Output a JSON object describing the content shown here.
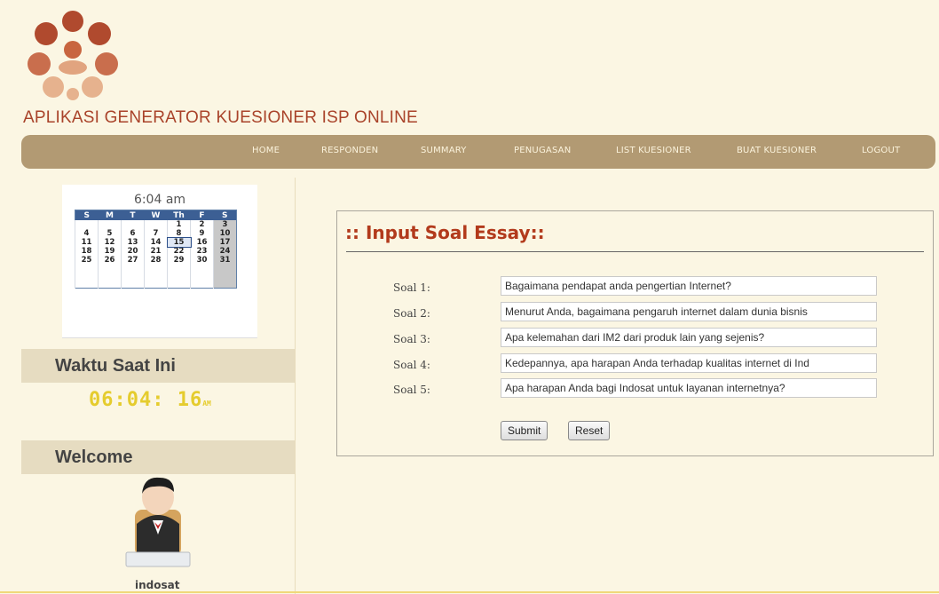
{
  "app": {
    "title": "APLIKASI GENERATOR KUESIONER ISP ONLINE"
  },
  "nav": {
    "items": [
      {
        "label": "HOME"
      },
      {
        "label": "RESPONDEN"
      },
      {
        "label": "SUMMARY"
      },
      {
        "label": "PENUGASAN"
      },
      {
        "label": "LIST KUESIONER"
      },
      {
        "label": "BUAT KUESIONER"
      },
      {
        "label": "LOGOUT"
      }
    ]
  },
  "calendar": {
    "time": "6:04 am",
    "weekdays": [
      "S",
      "M",
      "T",
      "W",
      "Th",
      "F",
      "S"
    ],
    "weeks": [
      [
        "",
        "",
        "",
        "",
        "1",
        "2",
        "3"
      ],
      [
        "4",
        "5",
        "6",
        "7",
        "8",
        "9",
        "10"
      ],
      [
        "11",
        "12",
        "13",
        "14",
        "15",
        "16",
        "17"
      ],
      [
        "18",
        "19",
        "20",
        "21",
        "22",
        "23",
        "24"
      ],
      [
        "25",
        "26",
        "27",
        "28",
        "29",
        "30",
        "31"
      ]
    ],
    "today": "15"
  },
  "sidebar": {
    "clock_heading": "Waktu Saat Ini",
    "clock_value": "06:04: 16",
    "clock_ampm": "AM",
    "welcome_heading": "Welcome",
    "username": "indosat"
  },
  "form": {
    "title": ":: Input Soal Essay::",
    "questions": [
      {
        "label": "Soal 1:",
        "value": "Bagaimana pendapat anda pengertian Internet?"
      },
      {
        "label": "Soal 2:",
        "value": "Menurut Anda, bagaimana pengaruh internet dalam dunia bisnis"
      },
      {
        "label": "Soal 3:",
        "value": "Apa kelemahan dari IM2 dari produk lain yang sejenis?"
      },
      {
        "label": "Soal 4:",
        "value": "Kedepannya, apa harapan Anda terhadap kualitas internet di Ind"
      },
      {
        "label": "Soal 5:",
        "value": "Apa harapan Anda bagi Indosat untuk layanan internetnya?"
      }
    ],
    "submit_label": "Submit",
    "reset_label": "Reset"
  },
  "colors": {
    "brand": "#a9432a",
    "nav_bar": "#b29a73",
    "section_bar": "#e6dcc1",
    "page_bg": "#fbf6e3",
    "clock": "#e5cc2e"
  }
}
